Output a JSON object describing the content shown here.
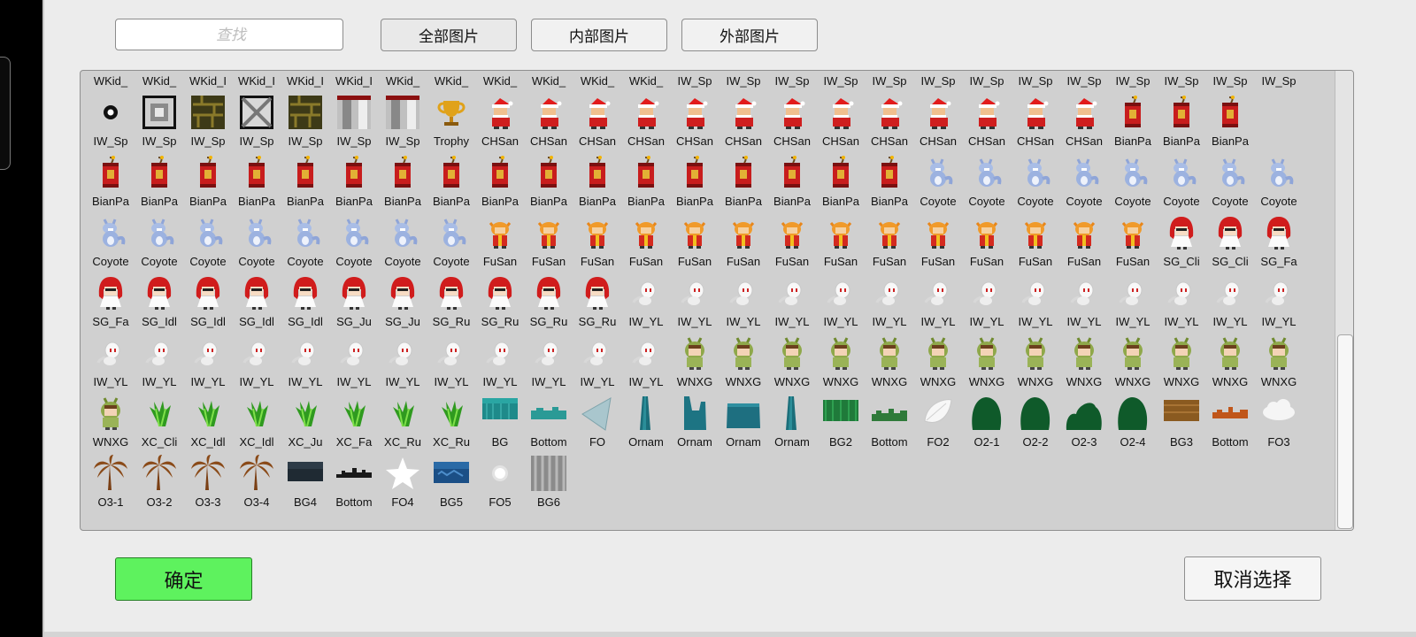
{
  "toolbar": {
    "search_placeholder": "查找",
    "filter_all_label": "全部图片",
    "filter_inner_label": "内部图片",
    "filter_outer_label": "外部图片"
  },
  "grid": {
    "rows": [
      [
        {
          "label": "WKid_",
          "icon": "kid-sprite-icon"
        },
        {
          "label": "WKid_",
          "icon": "kid-sprite-icon"
        },
        {
          "label": "WKid_I",
          "icon": "kid-sprite-icon"
        },
        {
          "label": "WKid_I",
          "icon": "kid-sprite-icon"
        },
        {
          "label": "WKid_I",
          "icon": "kid-sprite-icon"
        },
        {
          "label": "WKid_I",
          "icon": "kid-sprite-icon"
        },
        {
          "label": "WKid_",
          "icon": "kid-sprite-icon"
        },
        {
          "label": "WKid_",
          "icon": "kid-sprite-icon"
        },
        {
          "label": "WKid_",
          "icon": "kid-sprite-icon"
        },
        {
          "label": "WKid_",
          "icon": "kid-sprite-icon"
        },
        {
          "label": "WKid_",
          "icon": "kid-sprite-icon"
        },
        {
          "label": "WKid_",
          "icon": "kid-sprite-icon"
        },
        {
          "label": "IW_Sp",
          "icon": "block-tile-icon"
        },
        {
          "label": "IW_Sp",
          "icon": "block-tile-icon"
        },
        {
          "label": "IW_Sp",
          "icon": "block-tile-icon"
        },
        {
          "label": "IW_Sp",
          "icon": "block-tile-icon"
        },
        {
          "label": "IW_Sp",
          "icon": "block-tile-icon"
        },
        {
          "label": "IW_Sp",
          "icon": "block-tile-icon"
        },
        {
          "label": "IW_Sp",
          "icon": "block-tile-icon"
        },
        {
          "label": "IW_Sp",
          "icon": "block-tile-icon"
        },
        {
          "label": "IW_Sp",
          "icon": "block-tile-icon"
        },
        {
          "label": "IW_Sp",
          "icon": "block-tile-icon"
        },
        {
          "label": "IW_Sp",
          "icon": "block-tile-icon"
        },
        {
          "label": "IW_Sp",
          "icon": "block-tile-icon"
        },
        {
          "label": "IW_Sp",
          "icon": "block-tile-icon"
        }
      ],
      [
        {
          "label": "IW_Sp",
          "icon": "ring-icon"
        },
        {
          "label": "IW_Sp",
          "icon": "frame-block-icon"
        },
        {
          "label": "IW_Sp",
          "icon": "brick-block-icon"
        },
        {
          "label": "IW_Sp",
          "icon": "cross-block-icon"
        },
        {
          "label": "IW_Sp",
          "icon": "brick-block-icon"
        },
        {
          "label": "IW_Sp",
          "icon": "striped-block-icon"
        },
        {
          "label": "IW_Sp",
          "icon": "striped-block-icon"
        },
        {
          "label": "Trophy",
          "icon": "trophy-icon"
        },
        {
          "label": "CHSan",
          "icon": "santa-sprite-icon"
        },
        {
          "label": "CHSan",
          "icon": "santa-sprite-icon"
        },
        {
          "label": "CHSan",
          "icon": "santa-sprite-icon"
        },
        {
          "label": "CHSan",
          "icon": "santa-sprite-icon"
        },
        {
          "label": "CHSan",
          "icon": "santa-sprite-icon"
        },
        {
          "label": "CHSan",
          "icon": "santa-sprite-icon"
        },
        {
          "label": "CHSan",
          "icon": "santa-sprite-icon"
        },
        {
          "label": "CHSan",
          "icon": "santa-sprite-icon"
        },
        {
          "label": "CHSan",
          "icon": "santa-sprite-icon"
        },
        {
          "label": "CHSan",
          "icon": "santa-sprite-icon"
        },
        {
          "label": "CHSan",
          "icon": "santa-sprite-icon"
        },
        {
          "label": "CHSan",
          "icon": "santa-sprite-icon"
        },
        {
          "label": "CHSan",
          "icon": "santa-sprite-icon"
        },
        {
          "label": "BianPa",
          "icon": "firecracker-icon"
        },
        {
          "label": "BianPa",
          "icon": "firecracker-icon"
        },
        {
          "label": "BianPa",
          "icon": "firecracker-icon"
        }
      ],
      [
        {
          "label": "BianPa",
          "icon": "firecracker-icon"
        },
        {
          "label": "BianPa",
          "icon": "firecracker-icon"
        },
        {
          "label": "BianPa",
          "icon": "firecracker-icon"
        },
        {
          "label": "BianPa",
          "icon": "firecracker-icon"
        },
        {
          "label": "BianPa",
          "icon": "firecracker-icon"
        },
        {
          "label": "BianPa",
          "icon": "firecracker-icon"
        },
        {
          "label": "BianPa",
          "icon": "firecracker-icon"
        },
        {
          "label": "BianPa",
          "icon": "firecracker-icon"
        },
        {
          "label": "BianPa",
          "icon": "firecracker-icon"
        },
        {
          "label": "BianPa",
          "icon": "firecracker-icon"
        },
        {
          "label": "BianPa",
          "icon": "firecracker-icon"
        },
        {
          "label": "BianPa",
          "icon": "firecracker-icon"
        },
        {
          "label": "BianPa",
          "icon": "firecracker-icon"
        },
        {
          "label": "BianPa",
          "icon": "firecracker-icon"
        },
        {
          "label": "BianPa",
          "icon": "firecracker-icon"
        },
        {
          "label": "BianPa",
          "icon": "firecracker-icon"
        },
        {
          "label": "BianPa",
          "icon": "firecracker-icon"
        },
        {
          "label": "Coyote",
          "icon": "coyote-sprite-icon"
        },
        {
          "label": "Coyote",
          "icon": "coyote-sprite-icon"
        },
        {
          "label": "Coyote",
          "icon": "coyote-sprite-icon"
        },
        {
          "label": "Coyote",
          "icon": "coyote-sprite-icon"
        },
        {
          "label": "Coyote",
          "icon": "coyote-sprite-icon"
        },
        {
          "label": "Coyote",
          "icon": "coyote-sprite-icon"
        },
        {
          "label": "Coyote",
          "icon": "coyote-sprite-icon"
        },
        {
          "label": "Coyote",
          "icon": "coyote-sprite-icon"
        }
      ],
      [
        {
          "label": "Coyote",
          "icon": "coyote-sprite-icon"
        },
        {
          "label": "Coyote",
          "icon": "coyote-sprite-icon"
        },
        {
          "label": "Coyote",
          "icon": "coyote-sprite-icon"
        },
        {
          "label": "Coyote",
          "icon": "coyote-sprite-icon"
        },
        {
          "label": "Coyote",
          "icon": "coyote-sprite-icon"
        },
        {
          "label": "Coyote",
          "icon": "coyote-sprite-icon"
        },
        {
          "label": "Coyote",
          "icon": "coyote-sprite-icon"
        },
        {
          "label": "Coyote",
          "icon": "coyote-sprite-icon"
        },
        {
          "label": "FuSan",
          "icon": "fusan-sprite-icon"
        },
        {
          "label": "FuSan",
          "icon": "fusan-sprite-icon"
        },
        {
          "label": "FuSan",
          "icon": "fusan-sprite-icon"
        },
        {
          "label": "FuSan",
          "icon": "fusan-sprite-icon"
        },
        {
          "label": "FuSan",
          "icon": "fusan-sprite-icon"
        },
        {
          "label": "FuSan",
          "icon": "fusan-sprite-icon"
        },
        {
          "label": "FuSan",
          "icon": "fusan-sprite-icon"
        },
        {
          "label": "FuSan",
          "icon": "fusan-sprite-icon"
        },
        {
          "label": "FuSan",
          "icon": "fusan-sprite-icon"
        },
        {
          "label": "FuSan",
          "icon": "fusan-sprite-icon"
        },
        {
          "label": "FuSan",
          "icon": "fusan-sprite-icon"
        },
        {
          "label": "FuSan",
          "icon": "fusan-sprite-icon"
        },
        {
          "label": "FuSan",
          "icon": "fusan-sprite-icon"
        },
        {
          "label": "FuSan",
          "icon": "fusan-sprite-icon"
        },
        {
          "label": "SG_Cli",
          "icon": "red-hood-sprite-icon"
        },
        {
          "label": "SG_Cli",
          "icon": "red-hood-sprite-icon"
        },
        {
          "label": "SG_Fa",
          "icon": "red-hood-sprite-icon"
        }
      ],
      [
        {
          "label": "SG_Fa",
          "icon": "red-hood-sprite-icon"
        },
        {
          "label": "SG_Idl",
          "icon": "red-hood-sprite-icon"
        },
        {
          "label": "SG_Idl",
          "icon": "red-hood-sprite-icon"
        },
        {
          "label": "SG_Idl",
          "icon": "red-hood-sprite-icon"
        },
        {
          "label": "SG_Idl",
          "icon": "red-hood-sprite-icon"
        },
        {
          "label": "SG_Ju",
          "icon": "red-hood-sprite-icon"
        },
        {
          "label": "SG_Ju",
          "icon": "red-hood-sprite-icon"
        },
        {
          "label": "SG_Ru",
          "icon": "red-hood-sprite-icon"
        },
        {
          "label": "SG_Ru",
          "icon": "red-hood-sprite-icon"
        },
        {
          "label": "SG_Ru",
          "icon": "red-hood-sprite-icon"
        },
        {
          "label": "SG_Ru",
          "icon": "red-hood-sprite-icon"
        },
        {
          "label": "IW_YL",
          "icon": "ghost-sprite-icon"
        },
        {
          "label": "IW_YL",
          "icon": "ghost-sprite-icon"
        },
        {
          "label": "IW_YL",
          "icon": "ghost-sprite-icon"
        },
        {
          "label": "IW_YL",
          "icon": "ghost-sprite-icon"
        },
        {
          "label": "IW_YL",
          "icon": "ghost-sprite-icon"
        },
        {
          "label": "IW_YL",
          "icon": "ghost-sprite-icon"
        },
        {
          "label": "IW_YL",
          "icon": "ghost-sprite-icon"
        },
        {
          "label": "IW_YL",
          "icon": "ghost-sprite-icon"
        },
        {
          "label": "IW_YL",
          "icon": "ghost-sprite-icon"
        },
        {
          "label": "IW_YL",
          "icon": "ghost-sprite-icon"
        },
        {
          "label": "IW_YL",
          "icon": "ghost-sprite-icon"
        },
        {
          "label": "IW_YL",
          "icon": "ghost-sprite-icon"
        },
        {
          "label": "IW_YL",
          "icon": "ghost-sprite-icon"
        },
        {
          "label": "IW_YL",
          "icon": "ghost-sprite-icon"
        }
      ],
      [
        {
          "label": "IW_YL",
          "icon": "ghost-sprite-icon"
        },
        {
          "label": "IW_YL",
          "icon": "ghost-sprite-icon"
        },
        {
          "label": "IW_YL",
          "icon": "ghost-sprite-icon"
        },
        {
          "label": "IW_YL",
          "icon": "ghost-sprite-icon"
        },
        {
          "label": "IW_YL",
          "icon": "ghost-sprite-icon"
        },
        {
          "label": "IW_YL",
          "icon": "ghost-sprite-icon"
        },
        {
          "label": "IW_YL",
          "icon": "ghost-sprite-icon"
        },
        {
          "label": "IW_YL",
          "icon": "ghost-sprite-icon"
        },
        {
          "label": "IW_YL",
          "icon": "ghost-sprite-icon"
        },
        {
          "label": "IW_YL",
          "icon": "ghost-sprite-icon"
        },
        {
          "label": "IW_YL",
          "icon": "ghost-sprite-icon"
        },
        {
          "label": "IW_YL",
          "icon": "ghost-sprite-icon"
        },
        {
          "label": "WNXG",
          "icon": "green-hood-sprite-icon"
        },
        {
          "label": "WNXG",
          "icon": "green-hood-sprite-icon"
        },
        {
          "label": "WNXG",
          "icon": "green-hood-sprite-icon"
        },
        {
          "label": "WNXG",
          "icon": "green-hood-sprite-icon"
        },
        {
          "label": "WNXG",
          "icon": "green-hood-sprite-icon"
        },
        {
          "label": "WNXG",
          "icon": "green-hood-sprite-icon"
        },
        {
          "label": "WNXG",
          "icon": "green-hood-sprite-icon"
        },
        {
          "label": "WNXG",
          "icon": "green-hood-sprite-icon"
        },
        {
          "label": "WNXG",
          "icon": "green-hood-sprite-icon"
        },
        {
          "label": "WNXG",
          "icon": "green-hood-sprite-icon"
        },
        {
          "label": "WNXG",
          "icon": "green-hood-sprite-icon"
        },
        {
          "label": "WNXG",
          "icon": "green-hood-sprite-icon"
        },
        {
          "label": "WNXG",
          "icon": "green-hood-sprite-icon"
        }
      ],
      [
        {
          "label": "WNXG",
          "icon": "green-hood-sprite-icon"
        },
        {
          "label": "XC_Cli",
          "icon": "grass-sprite-icon"
        },
        {
          "label": "XC_Idl",
          "icon": "grass-sprite-icon"
        },
        {
          "label": "XC_Idl",
          "icon": "grass-sprite-icon"
        },
        {
          "label": "XC_Ju",
          "icon": "grass-sprite-icon"
        },
        {
          "label": "XC_Fa",
          "icon": "grass-sprite-icon"
        },
        {
          "label": "XC_Ru",
          "icon": "grass-sprite-icon"
        },
        {
          "label": "XC_Ru",
          "icon": "grass-sprite-icon"
        },
        {
          "label": "BG",
          "icon": "teal-background-icon"
        },
        {
          "label": "Bottom",
          "icon": "teal-ground-icon"
        },
        {
          "label": "FO",
          "icon": "triangle-shard-icon"
        },
        {
          "label": "Ornam",
          "icon": "teal-pillar-icon"
        },
        {
          "label": "Ornam",
          "icon": "teal-ruin-icon"
        },
        {
          "label": "Ornam",
          "icon": "teal-rock-icon"
        },
        {
          "label": "Ornam",
          "icon": "teal-pillar-icon"
        },
        {
          "label": "BG2",
          "icon": "green-background-icon"
        },
        {
          "label": "Bottom",
          "icon": "green-ground-icon"
        },
        {
          "label": "FO2",
          "icon": "leaf-icon"
        },
        {
          "label": "O2-1",
          "icon": "bush-icon"
        },
        {
          "label": "O2-2",
          "icon": "bush-icon"
        },
        {
          "label": "O2-3",
          "icon": "double-bush-icon"
        },
        {
          "label": "O2-4",
          "icon": "bush-icon"
        },
        {
          "label": "BG3",
          "icon": "brown-background-icon"
        },
        {
          "label": "Bottom",
          "icon": "orange-ground-icon"
        },
        {
          "label": "FO3",
          "icon": "cloud-icon"
        }
      ],
      [
        {
          "label": "O3-1",
          "icon": "palm-tree-icon"
        },
        {
          "label": "O3-2",
          "icon": "palm-tree-icon"
        },
        {
          "label": "O3-3",
          "icon": "palm-tree-icon"
        },
        {
          "label": "O3-4",
          "icon": "palm-tree-icon"
        },
        {
          "label": "BG4",
          "icon": "dark-background-icon"
        },
        {
          "label": "Bottom",
          "icon": "black-skyline-icon"
        },
        {
          "label": "FO4",
          "icon": "white-star-icon"
        },
        {
          "label": "BG5",
          "icon": "blue-background-icon"
        },
        {
          "label": "FO5",
          "icon": "white-dot-icon"
        },
        {
          "label": "BG6",
          "icon": "gray-striped-background-icon"
        }
      ]
    ]
  },
  "footer": {
    "confirm_label": "确定",
    "cancel_label": "取消选择"
  },
  "colors": {
    "confirm_green": "#5ef25e",
    "grid_background": "#d0d0d0",
    "panel_background": "#ececec"
  }
}
